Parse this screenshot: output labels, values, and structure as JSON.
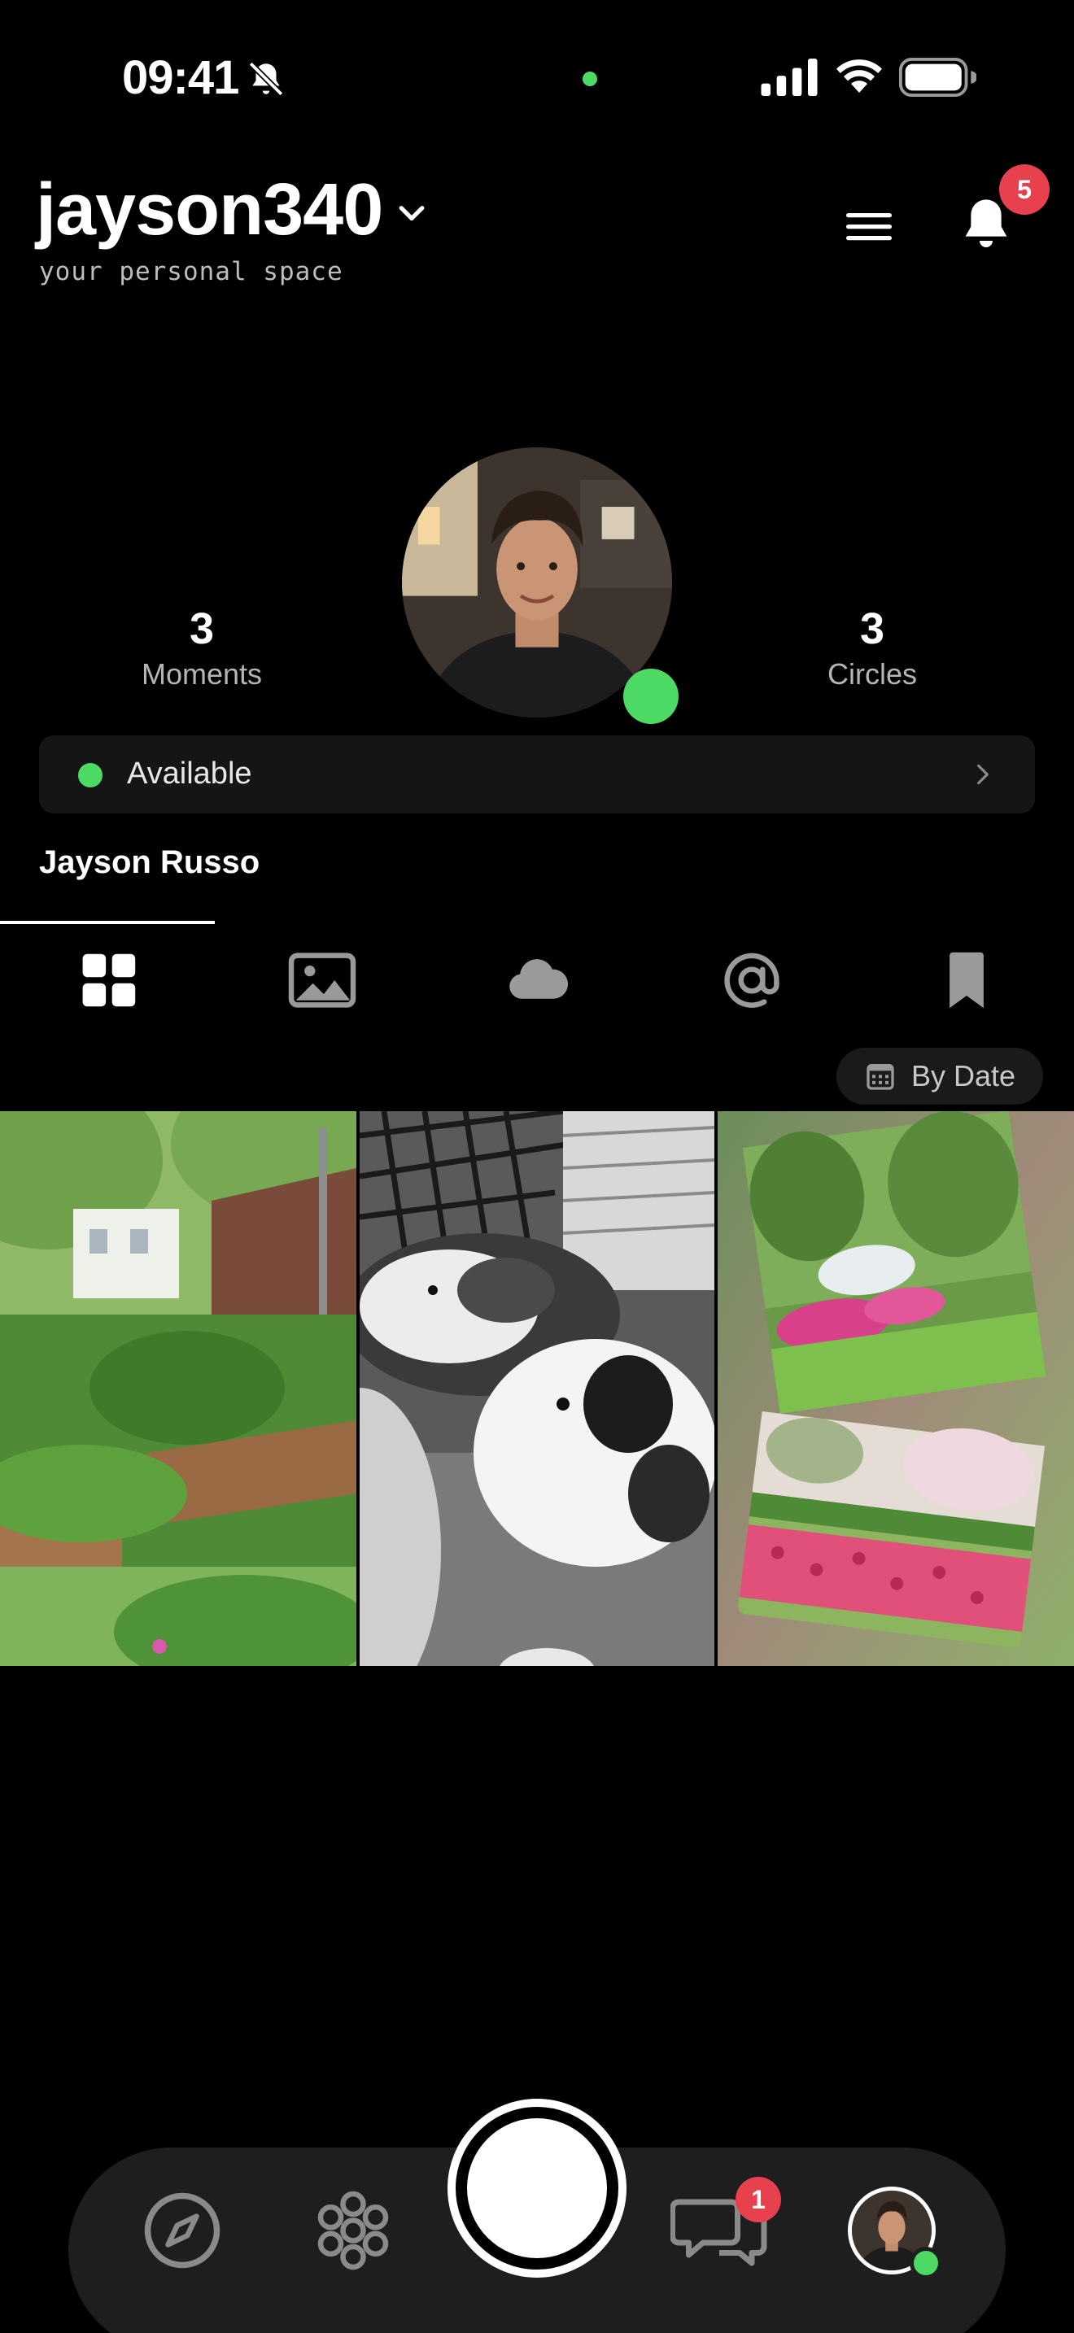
{
  "status_bar": {
    "time": "09:41",
    "icons": [
      "bell-slash-icon",
      "camera-indicator",
      "cellular-signal-icon",
      "wifi-icon",
      "battery-icon"
    ]
  },
  "header": {
    "username": "jayson340",
    "subtitle": "your personal space",
    "notification_count": "5",
    "icons": [
      "chevron-down-icon",
      "menu-icon",
      "bell-icon"
    ]
  },
  "profile": {
    "moments_count": "3",
    "moments_label": "Moments",
    "circles_count": "3",
    "circles_label": "Circles",
    "availability": "Available",
    "full_name": "Jayson Russo"
  },
  "tabs": [
    {
      "name": "grid",
      "icon": "grid-icon",
      "selected": true
    },
    {
      "name": "photos",
      "icon": "image-icon",
      "selected": false
    },
    {
      "name": "cloud",
      "icon": "cloud-icon",
      "selected": false
    },
    {
      "name": "mentions",
      "icon": "at-icon",
      "selected": false
    },
    {
      "name": "saved",
      "icon": "bookmark-icon",
      "selected": false
    }
  ],
  "sort": {
    "label": "By Date",
    "icon": "calendar-icon"
  },
  "moments": [
    {
      "name": "garden-raised-beds"
    },
    {
      "name": "guinea-pigs-bw"
    },
    {
      "name": "flower-gardens-collage"
    }
  ],
  "bottom_nav": {
    "items": [
      "compass-icon",
      "circles-icon",
      "capture-button",
      "chat-icon",
      "profile-avatar"
    ],
    "chat_badge": "1"
  },
  "colors": {
    "background": "#000000",
    "online": "#4cd964",
    "badge": "#e8414e",
    "surface": "#151515",
    "nav_surface": "#1e1e1e"
  }
}
